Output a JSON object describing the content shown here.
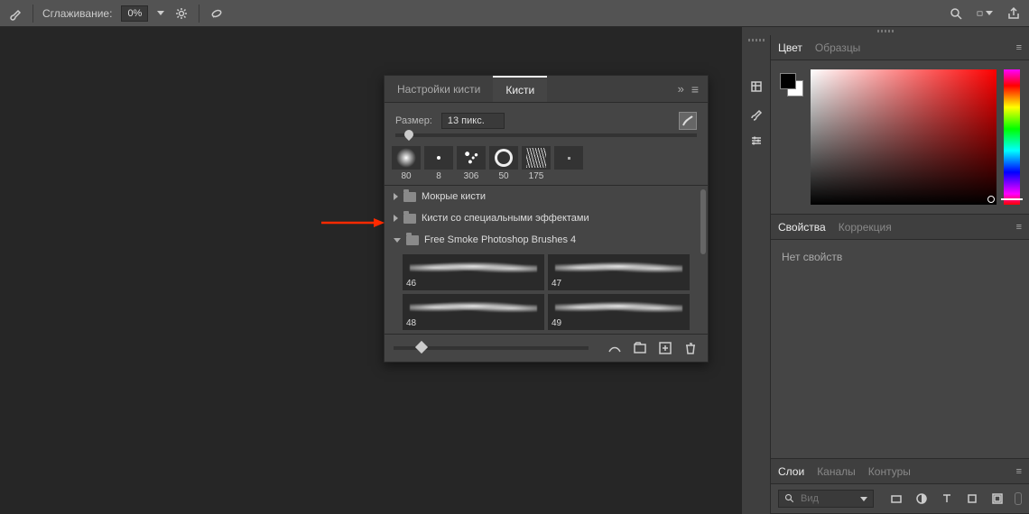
{
  "topbar": {
    "smoothing_label": "Сглаживание:",
    "smoothing_value": "0%"
  },
  "brush_panel": {
    "tabs": {
      "settings": "Настройки кисти",
      "brushes": "Кисти"
    },
    "size_label": "Размер:",
    "size_value": "13 пикс.",
    "presets": [
      {
        "label": "80"
      },
      {
        "label": "8"
      },
      {
        "label": "306"
      },
      {
        "label": "50"
      },
      {
        "label": "175"
      },
      {
        "label": ""
      }
    ],
    "folders": [
      {
        "name": "Мокрые кисти",
        "open": false
      },
      {
        "name": "Кисти со специальными эффектами",
        "open": false
      },
      {
        "name": "Free Smoke Photoshop Brushes 4",
        "open": true
      }
    ],
    "smoke_brushes": [
      "46",
      "47",
      "48",
      "49"
    ]
  },
  "color_panel": {
    "tabs": {
      "color": "Цвет",
      "swatches": "Образцы"
    }
  },
  "properties_panel": {
    "tabs": {
      "props": "Свойства",
      "adjust": "Коррекция"
    },
    "empty_text": "Нет свойств"
  },
  "layers_panel": {
    "tabs": {
      "layers": "Слои",
      "channels": "Каналы",
      "paths": "Контуры"
    },
    "search_placeholder": "Вид"
  }
}
